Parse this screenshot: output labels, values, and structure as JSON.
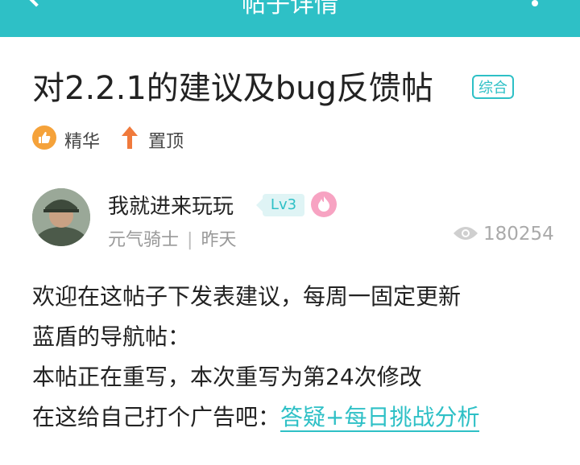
{
  "header": {
    "title": "帖子详情"
  },
  "post": {
    "title": "对2.2.1的建议及bug反馈帖",
    "tag": "综合",
    "badges": {
      "essence": "精华",
      "pinned": "置顶"
    }
  },
  "author": {
    "name": "我就进来玩玩",
    "level": "Lv3",
    "role": "元气骑士",
    "separator": "|",
    "time": "昨天"
  },
  "stats": {
    "views": "180254"
  },
  "content": {
    "line1": "欢迎在这帖子下发表建议，每周一固定更新",
    "line2": "蓝盾的导航帖：",
    "line3": "本帖正在重写，本次重写为第24次修改",
    "line4_prefix": "在这给自己打个广告吧：",
    "line4_link": "答疑+每日挑战分析"
  },
  "colors": {
    "accent": "#2ec0c6",
    "essence": "#f5a23a",
    "pinned": "#f07a3c",
    "fire": "#f7a3c2"
  },
  "icons": [
    "back-arrow-icon",
    "more-dots-icon",
    "thumbs-up-icon",
    "arrow-up-icon",
    "fire-icon",
    "eye-icon"
  ]
}
